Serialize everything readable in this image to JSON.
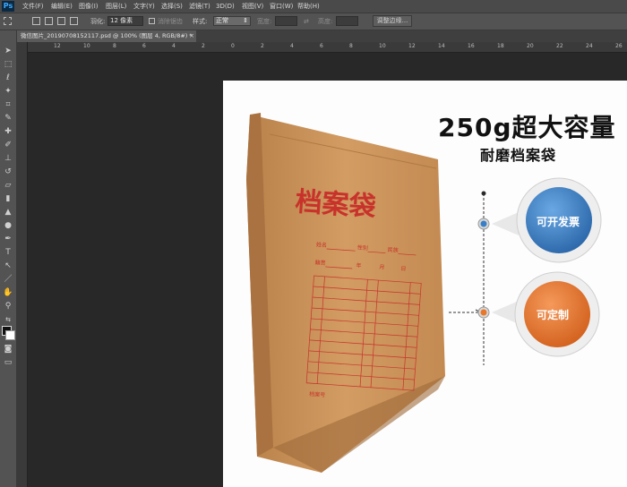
{
  "app": {
    "logo": "Ps"
  },
  "menu": [
    {
      "label": "文件(F)"
    },
    {
      "label": "编辑(E)"
    },
    {
      "label": "图像(I)"
    },
    {
      "label": "图层(L)"
    },
    {
      "label": "文字(Y)"
    },
    {
      "label": "选择(S)"
    },
    {
      "label": "滤镜(T)"
    },
    {
      "label": "3D(D)"
    },
    {
      "label": "视图(V)"
    },
    {
      "label": "窗口(W)"
    },
    {
      "label": "帮助(H)"
    }
  ],
  "options": {
    "feather_label": "羽化:",
    "feather_value": "12 像素",
    "antialias_label": "消除锯齿",
    "style_label": "样式:",
    "style_value": "正常",
    "width_label": "宽度:",
    "height_label": "高度:",
    "refine_button": "调整边缘..."
  },
  "document_tab": {
    "title": "微信图片_20190708152117.psd @ 100% (图层 4, RGB/8#) *",
    "close": "×"
  },
  "ruler": {
    "top_labels": [
      "12",
      "10",
      "8",
      "6",
      "4",
      "2",
      "0",
      "2",
      "4",
      "6",
      "8",
      "10",
      "12",
      "14",
      "16",
      "18",
      "20",
      "22",
      "24",
      "26",
      "28"
    ]
  },
  "artwork": {
    "headline": "250g超大容量",
    "subhead": "耐磨档案袋",
    "bag_title": "档案袋",
    "bag_fields": [
      "姓名",
      "性别",
      "民族",
      "籍贯",
      "年",
      "月",
      "日"
    ],
    "bag_bottom": "档案号",
    "bubble_top": "可开发票",
    "bubble_bottom": "可定制"
  },
  "colors": {
    "bubble_blue": "#3a7fc4",
    "bubble_orange": "#e8772b",
    "bag": "#c9925a"
  }
}
